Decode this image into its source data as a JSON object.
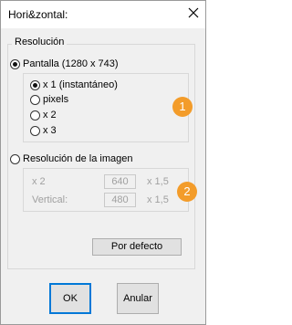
{
  "window": {
    "title": "Hori&zontal:"
  },
  "group": {
    "label": "Resolución"
  },
  "screen_option": {
    "label": "Pantalla (1280 x 743)",
    "selected": true
  },
  "zoom_options": [
    {
      "label": "x 1 (instantáneo)",
      "selected": true
    },
    {
      "label": "pixels",
      "selected": false
    },
    {
      "label": "x 2",
      "selected": false
    },
    {
      "label": "x 3",
      "selected": false
    }
  ],
  "image_option": {
    "label": "Resolución de la imagen",
    "selected": false
  },
  "image_fields": {
    "row1_label": "x 2",
    "row1_value": "640",
    "row1_scale": "x 1,5",
    "row2_label": "Vertical:",
    "row2_value": "480",
    "row2_scale": "x 1,5"
  },
  "badges": {
    "first": "1",
    "second": "2"
  },
  "buttons": {
    "default": "Por defecto",
    "ok": "OK",
    "cancel": "Anular"
  },
  "colors": {
    "badge": "#f39c2a",
    "focus": "#0078d7"
  }
}
